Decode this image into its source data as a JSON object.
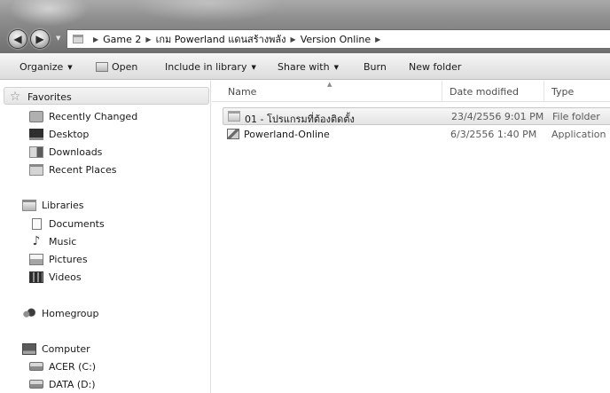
{
  "address": {
    "segments": [
      "Game 2",
      "เกม Powerland แดนสร้างพลัง",
      "Version Online"
    ]
  },
  "toolbar": {
    "organize": "Organize",
    "open": "Open",
    "include_in_library": "Include in library",
    "share_with": "Share with",
    "burn": "Burn",
    "new_folder": "New folder"
  },
  "nav": {
    "favorites": {
      "label": "Favorites",
      "items": [
        "Recently Changed",
        "Desktop",
        "Downloads",
        "Recent Places"
      ]
    },
    "libraries": {
      "label": "Libraries",
      "items": [
        "Documents",
        "Music",
        "Pictures",
        "Videos"
      ]
    },
    "homegroup": "Homegroup",
    "computer": {
      "label": "Computer",
      "items": [
        "ACER (C:)",
        "DATA (D:)"
      ]
    }
  },
  "columns": {
    "name": "Name",
    "date_modified": "Date modified",
    "type": "Type"
  },
  "files": [
    {
      "name": "01 - โปรแกรมที่ต้องติดตั้ง",
      "date": "23/4/2556 9:01 PM",
      "type": "File folder",
      "icon": "folder-icon",
      "selected": true
    },
    {
      "name": "Powerland-Online",
      "date": "6/3/2556 1:40 PM",
      "type": "Application",
      "icon": "application-icon",
      "selected": false
    }
  ]
}
